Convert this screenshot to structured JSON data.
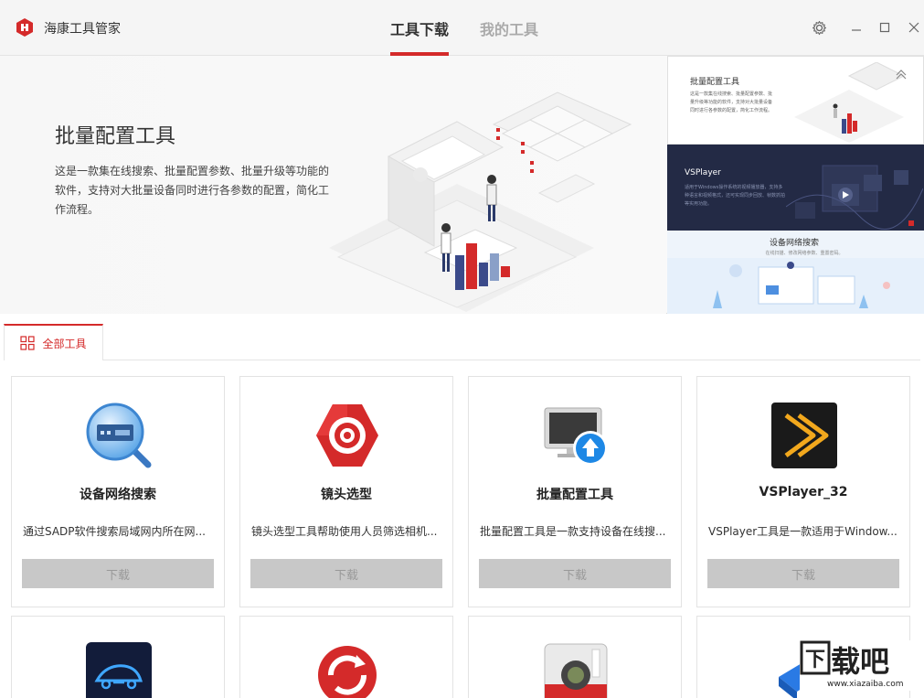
{
  "app": {
    "title": "海康工具管家"
  },
  "nav": {
    "tabs": [
      {
        "label": "工具下载"
      },
      {
        "label": "我的工具"
      }
    ]
  },
  "window": {
    "settings_icon": "gear-icon",
    "minimize_icon": "minimize-icon",
    "maximize_icon": "maximize-icon",
    "close_icon": "close-icon"
  },
  "banner": {
    "title": "批量配置工具",
    "description": "这是一款集在线搜索、批量配置参数、批量升级等功能的软件，支持对大批量设备同时进行各参数的配置，简化工作流程。",
    "thumbnails": [
      {
        "title": "批量配置工具",
        "desc": "这是一款集在线搜索、批量配置参数、批量升级等功能的软件，支持对大批量设备同时进行各参数的配置，简化工作流程。"
      },
      {
        "title": "VSPlayer",
        "desc": "适用于Windows操作系统的视频播放器，支持多种语言和视频格式，还可实现同步回放、帧数抓拍等实用功能。"
      },
      {
        "title": "设备网络搜索",
        "desc": "在线扫描、修改网络参数、重置密码。"
      }
    ]
  },
  "filter": {
    "label": "全部工具"
  },
  "accent_color": "#d42a2a",
  "tools": [
    {
      "name": "设备网络搜索",
      "desc": "通过SADP软件搜索局域网内所在网...",
      "button": "下载",
      "icon": "search-device-icon"
    },
    {
      "name": "镜头选型",
      "desc": "镜头选型工具帮助使用人员筛选相机...",
      "button": "下载",
      "icon": "lens-icon"
    },
    {
      "name": "批量配置工具",
      "desc": "批量配置工具是一款支持设备在线搜...",
      "button": "下载",
      "icon": "batch-config-icon"
    },
    {
      "name": "VSPlayer_32",
      "desc": "VSPlayer工具是一款适用于Window...",
      "button": "下载",
      "icon": "player-icon"
    }
  ],
  "watermark": {
    "brand": "下载吧",
    "url": "www.xiazaiba.com"
  }
}
